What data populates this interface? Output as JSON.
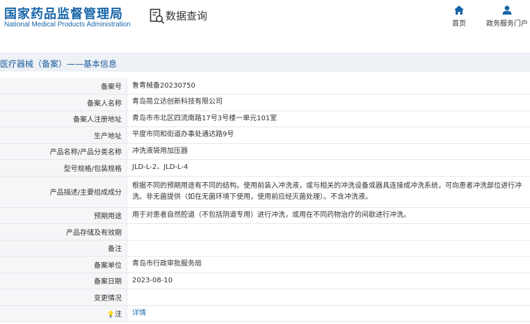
{
  "header": {
    "org_name_cn": "国家药品监督管理局",
    "org_name_en": "National Medical Products Administration",
    "page_title": "数据查询",
    "nav": {
      "home_label": "首页",
      "portal_label": "政务服务门户"
    }
  },
  "section": {
    "title": "医疗器械（备案）——基本信息"
  },
  "record": {
    "rows": [
      {
        "label": "备案号",
        "value": "鲁青械备20230750"
      },
      {
        "label": "备案人名称",
        "value": "青岛简立达创新科技有限公司"
      },
      {
        "label": "备案人注册地址",
        "value": "青岛市市北区四流南路17号3号楼一单元101室"
      },
      {
        "label": "生产地址",
        "value": "平度市同和街道办事处通达路9号"
      },
      {
        "label": "产品名称/产品分类名称",
        "value": "冲洗液袋用加压器"
      },
      {
        "label": "型号规格/包装规格",
        "value": "JLD-L-2、JLD-L-4"
      },
      {
        "label": "产品描述/主要组成成分",
        "value": "根据不同的预期用途有不同的结构。使用前装入冲洗液，或与相关的冲洗设备或器具连接成冲洗系统，可向患者冲洗部位进行冲洗。非无菌提供（如在无菌环境下使用，使用前应经灭菌处理）。不含冲洗液。"
      },
      {
        "label": "预期用途",
        "value": "用于对患者自然腔道（不包括阴道专用）进行冲洗，或用在不同药物治疗的间歇进行冲洗。"
      },
      {
        "label": "产品存储及有效期",
        "value": ""
      },
      {
        "label": "备注",
        "value": ""
      },
      {
        "label": "备案单位",
        "value": "青岛市行政审批服务局"
      },
      {
        "label": "备案日期",
        "value": "2023-08-10"
      },
      {
        "label": "变更情况",
        "value": ""
      },
      {
        "label": "注",
        "value": "详情"
      }
    ]
  },
  "colors": {
    "brand_blue": "#1765a8",
    "link_blue": "#2c6fb0",
    "label_bg": "#f5f6f8",
    "title_bar_bg": "#eef1f5"
  }
}
